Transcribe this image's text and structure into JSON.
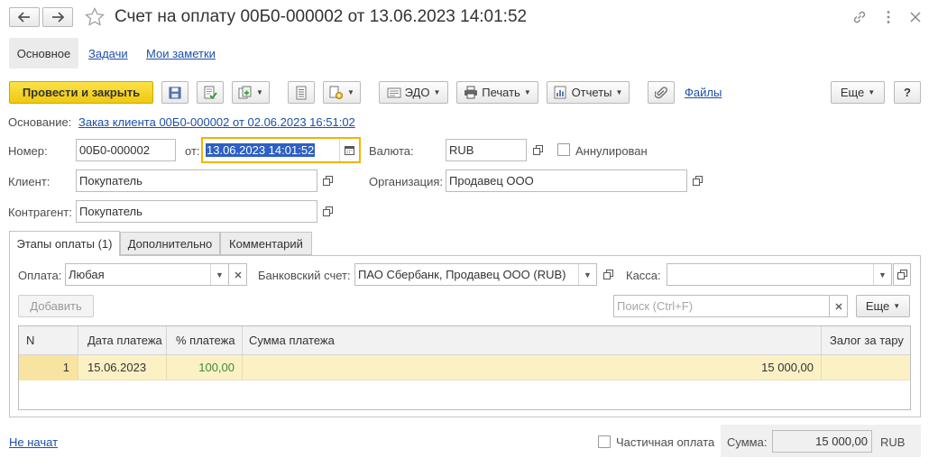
{
  "window": {
    "title": "Счет на оплату 00Б0-000002 от 13.06.2023 14:01:52"
  },
  "tabs": [
    "Основное",
    "Задачи",
    "Мои заметки"
  ],
  "toolbar": {
    "post_close": "Провести и закрыть",
    "edo": "ЭДО",
    "print": "Печать",
    "reports": "Отчеты",
    "files": "Файлы",
    "more": "Еще",
    "help": "?"
  },
  "basis": {
    "label": "Основание:",
    "value": "Заказ клиента 00Б0-000002 от 02.06.2023 16:51:02"
  },
  "fields": {
    "number_label": "Номер:",
    "number": "00Б0-000002",
    "date_label": "от:",
    "date": "13.06.2023 14:01:52",
    "currency_label": "Валюта:",
    "currency": "RUB",
    "cancelled_label": "Аннулирован",
    "client_label": "Клиент:",
    "client": "Покупатель",
    "org_label": "Организация:",
    "org": "Продавец ООО",
    "counterparty_label": "Контрагент:",
    "counterparty": "Покупатель"
  },
  "inner_tabs": [
    "Этапы оплаты (1)",
    "Дополнительно",
    "Комментарий"
  ],
  "payment": {
    "pay_label": "Оплата:",
    "pay_value": "Любая",
    "bank_label": "Банковский счет:",
    "bank_value": "ПАО Сбербанк, Продавец ООО (RUB)",
    "cash_label": "Касса:",
    "cash_value": "",
    "add": "Добавить",
    "search_placeholder": "Поиск (Ctrl+F)",
    "more": "Еще"
  },
  "table": {
    "headers": [
      "N",
      "Дата платежа",
      "% платежа",
      "Сумма платежа",
      "Залог за тару"
    ],
    "rows": [
      {
        "n": "1",
        "date": "15.06.2023",
        "percent": "100,00",
        "sum": "15 000,00",
        "deposit": ""
      }
    ]
  },
  "footer": {
    "status": "Не начат",
    "partial_label": "Частичная оплата",
    "sum_label": "Сумма:",
    "sum_value": "15 000,00",
    "currency": "RUB"
  },
  "colors": {
    "accent_yellow": "#f5d21f",
    "row_highlight": "#fbf1c4",
    "link": "#1c4fa7",
    "percent_green": "#3d8a3d",
    "date_focus": "#f0b400"
  }
}
